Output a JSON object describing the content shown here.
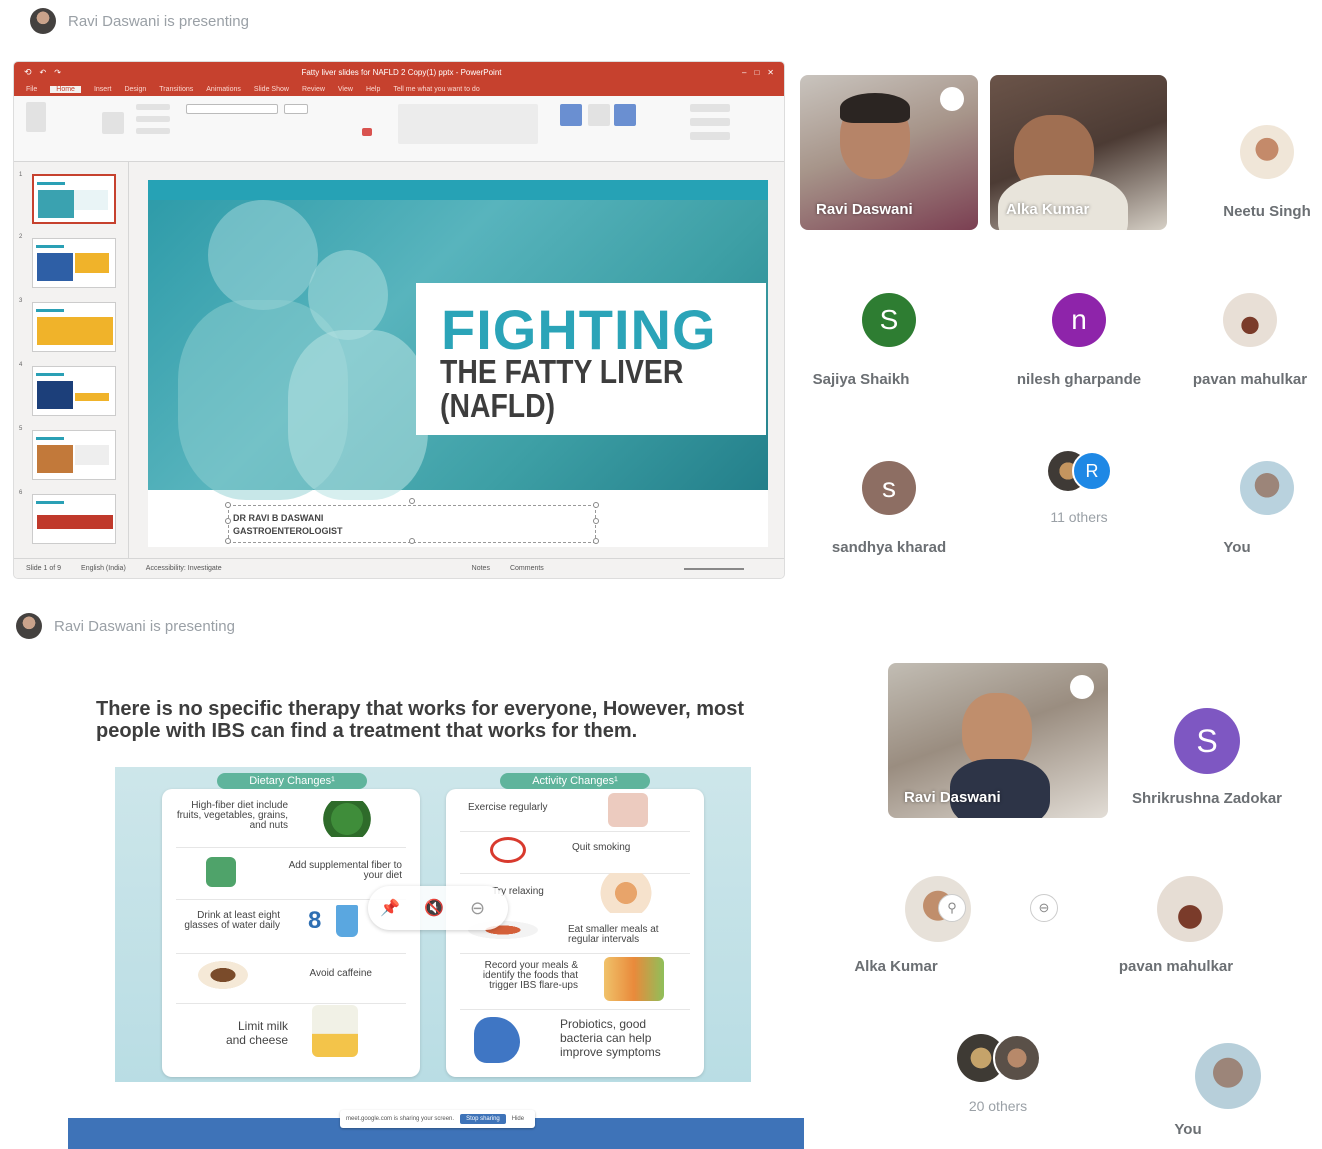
{
  "top": {
    "presenting": "Ravi Daswani is presenting",
    "ppt": {
      "title_bar": "Fatty liver slides for NAFLD 2 Copy(1) pptx - PowerPoint",
      "tabs": [
        "File",
        "Home",
        "Insert",
        "Design",
        "Transitions",
        "Animations",
        "Slide Show",
        "Review",
        "View",
        "Help",
        "Tell me what you want to do"
      ],
      "slide": {
        "headline": "FIGHTING",
        "subline1": "THE FATTY LIVER",
        "subline2": "(NAFLD)",
        "speaker1": "DR RAVI B DASWANI",
        "speaker2": "GASTROENTEROLOGIST"
      },
      "thumb_numbers": [
        "1",
        "2",
        "3",
        "4",
        "5",
        "6"
      ],
      "status": [
        "Slide 1 of 9",
        "English (India)",
        "Accessibility: Investigate",
        "Notes",
        "Comments"
      ]
    },
    "tiles": [
      {
        "name": "Ravi Daswani"
      },
      {
        "name": "Alka Kumar"
      }
    ],
    "participants": [
      {
        "name": "Neetu Singh"
      },
      {
        "name": "Sajiya Shaikh",
        "initial": "S",
        "color": "#2e7d32"
      },
      {
        "name": "nilesh gharpande",
        "initial": "n",
        "color": "#8e24aa"
      },
      {
        "name": "pavan mahulkar"
      },
      {
        "name": "sandhya kharad",
        "initial": "s",
        "color": "#8d6e63"
      },
      {
        "name": "11 others",
        "initial": "R",
        "color": "#1e88e5"
      },
      {
        "name": "You"
      }
    ]
  },
  "bottom": {
    "presenting": "Ravi Daswani is presenting",
    "heading": "There is no specific therapy that works for everyone, However, most people with IBS can find a treatment that works for them.",
    "dietary": {
      "title": "Dietary Changes¹",
      "items": [
        "High-fiber diet include fruits, vegetables, grains, and nuts",
        "Add supplemental fiber to your diet",
        "Drink at least eight glasses of water daily",
        "Avoid caffeine",
        "Limit milk and cheese"
      ],
      "eight": "8"
    },
    "activity": {
      "title": "Activity Changes¹",
      "items": [
        "Exercise regularly",
        "Quit smoking",
        "Try relaxing",
        "Eat smaller meals at regular intervals",
        "Record your meals & identify the foods that trigger IBS flare-ups",
        "Probiotics, good bacteria can help improve symptoms"
      ]
    },
    "sharing": {
      "text": "meet.google.com is sharing your screen.",
      "stop": "Stop sharing",
      "hide": "Hide"
    },
    "tile": {
      "name": "Ravi Daswani"
    },
    "participants": [
      {
        "name": "Shrikrushna Zadokar",
        "initial": "S",
        "color": "#7e57c2"
      },
      {
        "name": "Alka Kumar"
      },
      {
        "name": "pavan mahulkar"
      },
      {
        "name": "20 others"
      },
      {
        "name": "You"
      }
    ]
  }
}
